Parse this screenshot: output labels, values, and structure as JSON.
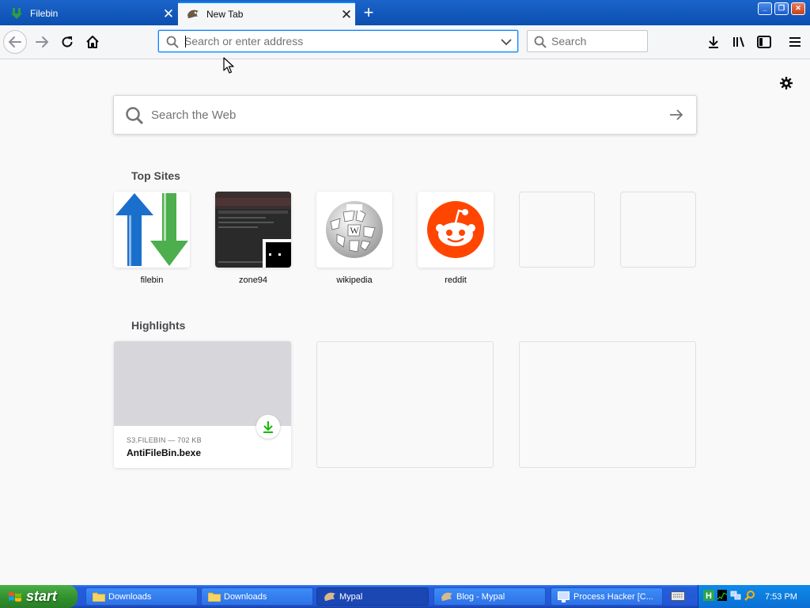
{
  "tabs": [
    {
      "title": "Filebin",
      "active": false
    },
    {
      "title": "New Tab",
      "active": true
    }
  ],
  "urlbar": {
    "placeholder": "Search or enter address",
    "value": ""
  },
  "searchbar": {
    "placeholder": "Search"
  },
  "newtab": {
    "search_placeholder": "Search the Web",
    "top_sites_title": "Top Sites",
    "top_sites": [
      {
        "label": "filebin"
      },
      {
        "label": "zone94"
      },
      {
        "label": "wikipedia"
      },
      {
        "label": "reddit"
      },
      {
        "label": ""
      },
      {
        "label": ""
      }
    ],
    "highlights_title": "Highlights",
    "highlights": [
      {
        "source": "S3.FILEBIN — 702 KB",
        "title": "AntiFileBin.bexe"
      }
    ]
  },
  "taskbar": {
    "start_label": "start",
    "items": [
      {
        "label": "Downloads",
        "icon": "folder-icon",
        "active": false
      },
      {
        "label": "Downloads",
        "icon": "folder-icon",
        "active": false
      },
      {
        "label": "Mypal",
        "icon": "mypal-icon",
        "active": true
      },
      {
        "label": "Blog - Mypal",
        "icon": "mypal-icon",
        "active": false
      },
      {
        "label": "Process Hacker [C...",
        "icon": "process-hacker-icon",
        "active": false
      }
    ],
    "clock": "7:53 PM"
  },
  "colors": {
    "accent": "#0a84ff",
    "reddit": "#ff4500",
    "download_green": "#12bc00",
    "taskbar_blue": "#245edb",
    "start_green": "#3c9c39"
  }
}
